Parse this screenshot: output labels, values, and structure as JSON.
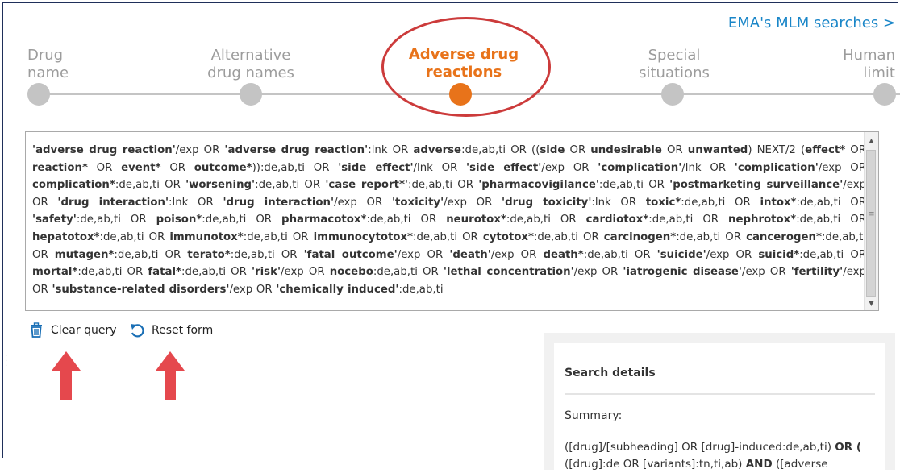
{
  "header": {
    "mlm_link": "EMA's MLM searches >"
  },
  "steps": [
    {
      "line1": "Drug",
      "line2": "name",
      "active": false
    },
    {
      "line1": "Alternative",
      "line2": "drug names",
      "active": false
    },
    {
      "line1": "Adverse drug",
      "line2": "reactions",
      "active": true
    },
    {
      "line1": "Special",
      "line2": "situations",
      "active": false
    },
    {
      "line1": "Human",
      "line2": "limit",
      "active": false
    }
  ],
  "query": {
    "segments": [
      [
        "b",
        "'adverse drug reaction'"
      ],
      [
        "t",
        "/exp OR "
      ],
      [
        "b",
        "'adverse drug reaction'"
      ],
      [
        "t",
        ":lnk OR "
      ],
      [
        "b",
        "adverse"
      ],
      [
        "t",
        ":de,ab,ti OR (("
      ],
      [
        "b",
        "side"
      ],
      [
        "t",
        " OR "
      ],
      [
        "b",
        "undesirable"
      ],
      [
        "t",
        " OR "
      ],
      [
        "b",
        "unwanted"
      ],
      [
        "t",
        ") NEXT/2 ("
      ],
      [
        "b",
        "effect*"
      ],
      [
        "t",
        " OR "
      ],
      [
        "b",
        "reaction*"
      ],
      [
        "t",
        " OR "
      ],
      [
        "b",
        "event*"
      ],
      [
        "t",
        " OR "
      ],
      [
        "b",
        "outcome*"
      ],
      [
        "t",
        ")):de,ab,ti OR "
      ],
      [
        "b",
        "'side effect'"
      ],
      [
        "t",
        "/lnk OR "
      ],
      [
        "b",
        "'side effect'"
      ],
      [
        "t",
        "/exp OR "
      ],
      [
        "b",
        "'complication'"
      ],
      [
        "t",
        "/lnk OR "
      ],
      [
        "b",
        "'complication'"
      ],
      [
        "t",
        "/exp OR "
      ],
      [
        "b",
        "complication*"
      ],
      [
        "t",
        ":de,ab,ti OR "
      ],
      [
        "b",
        "'worsening'"
      ],
      [
        "t",
        ":de,ab,ti OR "
      ],
      [
        "b",
        "'case report*'"
      ],
      [
        "t",
        ":de,ab,ti OR "
      ],
      [
        "b",
        "'pharmacovigilance'"
      ],
      [
        "t",
        ":de,ab,ti OR "
      ],
      [
        "b",
        "'postmarketing surveillance'"
      ],
      [
        "t",
        "/exp OR "
      ],
      [
        "b",
        "'drug interaction'"
      ],
      [
        "t",
        ":lnk OR "
      ],
      [
        "b",
        "'drug interaction'"
      ],
      [
        "t",
        "/exp OR "
      ],
      [
        "b",
        "'toxicity'"
      ],
      [
        "t",
        "/exp OR "
      ],
      [
        "b",
        "'drug toxicity'"
      ],
      [
        "t",
        ":lnk OR "
      ],
      [
        "b",
        "toxic*"
      ],
      [
        "t",
        ":de,ab,ti OR "
      ],
      [
        "b",
        "intox*"
      ],
      [
        "t",
        ":de,ab,ti OR "
      ],
      [
        "b",
        "'safety'"
      ],
      [
        "t",
        ":de,ab,ti OR "
      ],
      [
        "b",
        "poison*"
      ],
      [
        "t",
        ":de,ab,ti OR "
      ],
      [
        "b",
        "pharmacotox*"
      ],
      [
        "t",
        ":de,ab,ti OR "
      ],
      [
        "b",
        "neurotox*"
      ],
      [
        "t",
        ":de,ab,ti OR "
      ],
      [
        "b",
        "cardiotox*"
      ],
      [
        "t",
        ":de,ab,ti OR "
      ],
      [
        "b",
        "nephrotox*"
      ],
      [
        "t",
        ":de,ab,ti OR "
      ],
      [
        "b",
        "hepatotox*"
      ],
      [
        "t",
        ":de,ab,ti OR "
      ],
      [
        "b",
        "immunotox*"
      ],
      [
        "t",
        ":de,ab,ti OR "
      ],
      [
        "b",
        "immunocytotox*"
      ],
      [
        "t",
        ":de,ab,ti OR "
      ],
      [
        "b",
        "cytotox*"
      ],
      [
        "t",
        ":de,ab,ti OR "
      ],
      [
        "b",
        "carcinogen*"
      ],
      [
        "t",
        ":de,ab,ti OR "
      ],
      [
        "b",
        "cancerogen*"
      ],
      [
        "t",
        ":de,ab,ti OR "
      ],
      [
        "b",
        "mutagen*"
      ],
      [
        "t",
        ":de,ab,ti OR "
      ],
      [
        "b",
        "terato*"
      ],
      [
        "t",
        ":de,ab,ti OR "
      ],
      [
        "b",
        "'fatal outcome'"
      ],
      [
        "t",
        "/exp OR "
      ],
      [
        "b",
        "'death'"
      ],
      [
        "t",
        "/exp OR "
      ],
      [
        "b",
        "death*"
      ],
      [
        "t",
        ":de,ab,ti OR "
      ],
      [
        "b",
        "'suicide'"
      ],
      [
        "t",
        "/exp OR "
      ],
      [
        "b",
        "suicid*"
      ],
      [
        "t",
        ":de,ab,ti OR "
      ],
      [
        "b",
        "mortal*"
      ],
      [
        "t",
        ":de,ab,ti OR "
      ],
      [
        "b",
        "fatal*"
      ],
      [
        "t",
        ":de,ab,ti OR "
      ],
      [
        "b",
        "'risk'"
      ],
      [
        "t",
        "/exp OR "
      ],
      [
        "b",
        "nocebo"
      ],
      [
        "t",
        ":de,ab,ti OR "
      ],
      [
        "b",
        "'lethal concentration'"
      ],
      [
        "t",
        "/exp OR "
      ],
      [
        "b",
        "'iatrogenic disease'"
      ],
      [
        "t",
        "/exp OR "
      ],
      [
        "b",
        "'fertility'"
      ],
      [
        "t",
        "/exp OR "
      ],
      [
        "b",
        "'substance-related disorders'"
      ],
      [
        "t",
        "/exp OR "
      ],
      [
        "b",
        "'chemically induced'"
      ],
      [
        "t",
        ":de,ab,ti"
      ]
    ]
  },
  "actions": {
    "clear_label": "Clear query",
    "reset_label": "Reset form"
  },
  "details": {
    "title": "Search details",
    "summary_label": "Summary:",
    "summary_segments": [
      [
        "t",
        "([drug]/[subheading] OR [drug]-induced:de,ab,ti) "
      ],
      [
        "b",
        "OR ("
      ],
      [
        "t",
        " ([drug]:de OR [variants]:tn,ti,ab) "
      ],
      [
        "b",
        "AND"
      ],
      [
        "t",
        " ([adverse"
      ]
    ]
  },
  "colors": {
    "accent_orange": "#e8731a",
    "inactive_gray": "#c4c4c4",
    "link_blue": "#1a86c8",
    "annotation_red": "#cc3b3b"
  }
}
